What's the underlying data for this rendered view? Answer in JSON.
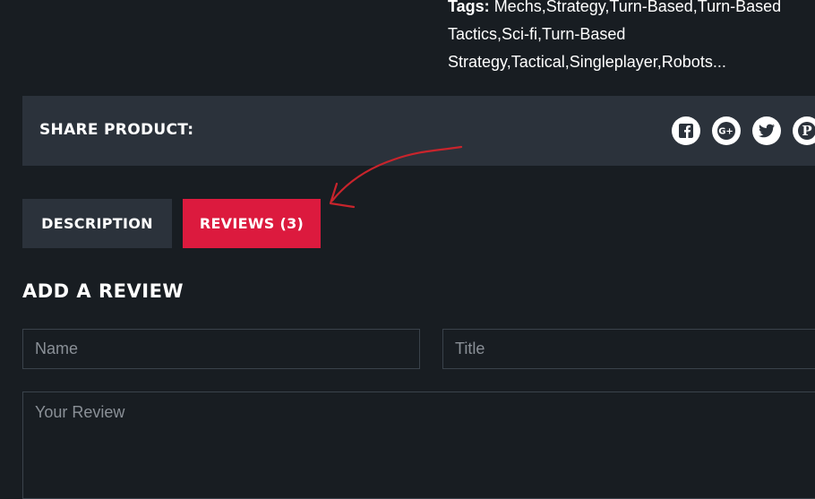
{
  "product": {
    "tags_label": "Tags:",
    "tags_line1": "Mechs,Strategy,Turn-Based,Turn-Based",
    "tags_line2": "Tactics,Sci-fi,Turn-Based",
    "tags_line3": "Strategy,Tactical,Singleplayer,Robots..."
  },
  "share": {
    "label": "SHARE PRODUCT:",
    "icons": [
      "facebook-icon",
      "google-plus-icon",
      "twitter-icon",
      "pinterest-icon"
    ]
  },
  "tabs": [
    {
      "label": "DESCRIPTION",
      "active": false
    },
    {
      "label": "REVIEWS (3)",
      "active": true
    }
  ],
  "review_form": {
    "heading": "ADD A REVIEW",
    "name_placeholder": "Name",
    "title_placeholder": "Title",
    "review_placeholder": "Your Review"
  },
  "colors": {
    "background": "#181d22",
    "panel": "#2b323b",
    "accent": "#dc1a3e",
    "annotation": "#c8242c"
  }
}
